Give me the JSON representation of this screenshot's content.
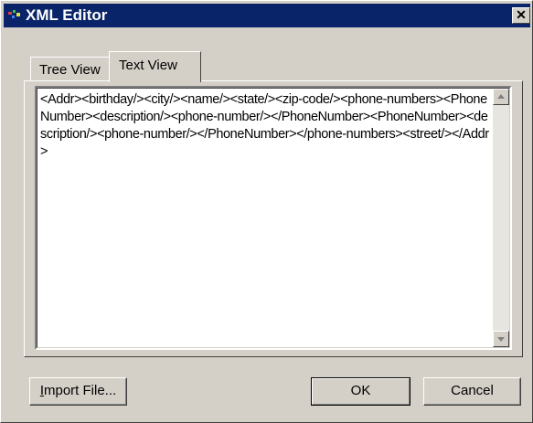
{
  "window": {
    "title": "XML Editor",
    "close_glyph": "✕"
  },
  "tabs": [
    {
      "label": "Tree View",
      "selected": false
    },
    {
      "label": "Text View",
      "selected": true
    }
  ],
  "editor": {
    "content": "<Addr><birthday/><city/><name/><state/><zip-code/><phone-numbers><PhoneNumber><description/><phone-number/></PhoneNumber><PhoneNumber><description/><phone-number/></PhoneNumber></phone-numbers><street/></Addr>"
  },
  "buttons": {
    "import_label_u": "I",
    "import_label_rest": "mport File...",
    "ok_label": "OK",
    "cancel_label": "Cancel"
  },
  "icons": {
    "app": "xml-app-icon",
    "close": "close-icon",
    "scroll_up": "scroll-up-arrow-icon",
    "scroll_down": "scroll-down-arrow-icon"
  }
}
